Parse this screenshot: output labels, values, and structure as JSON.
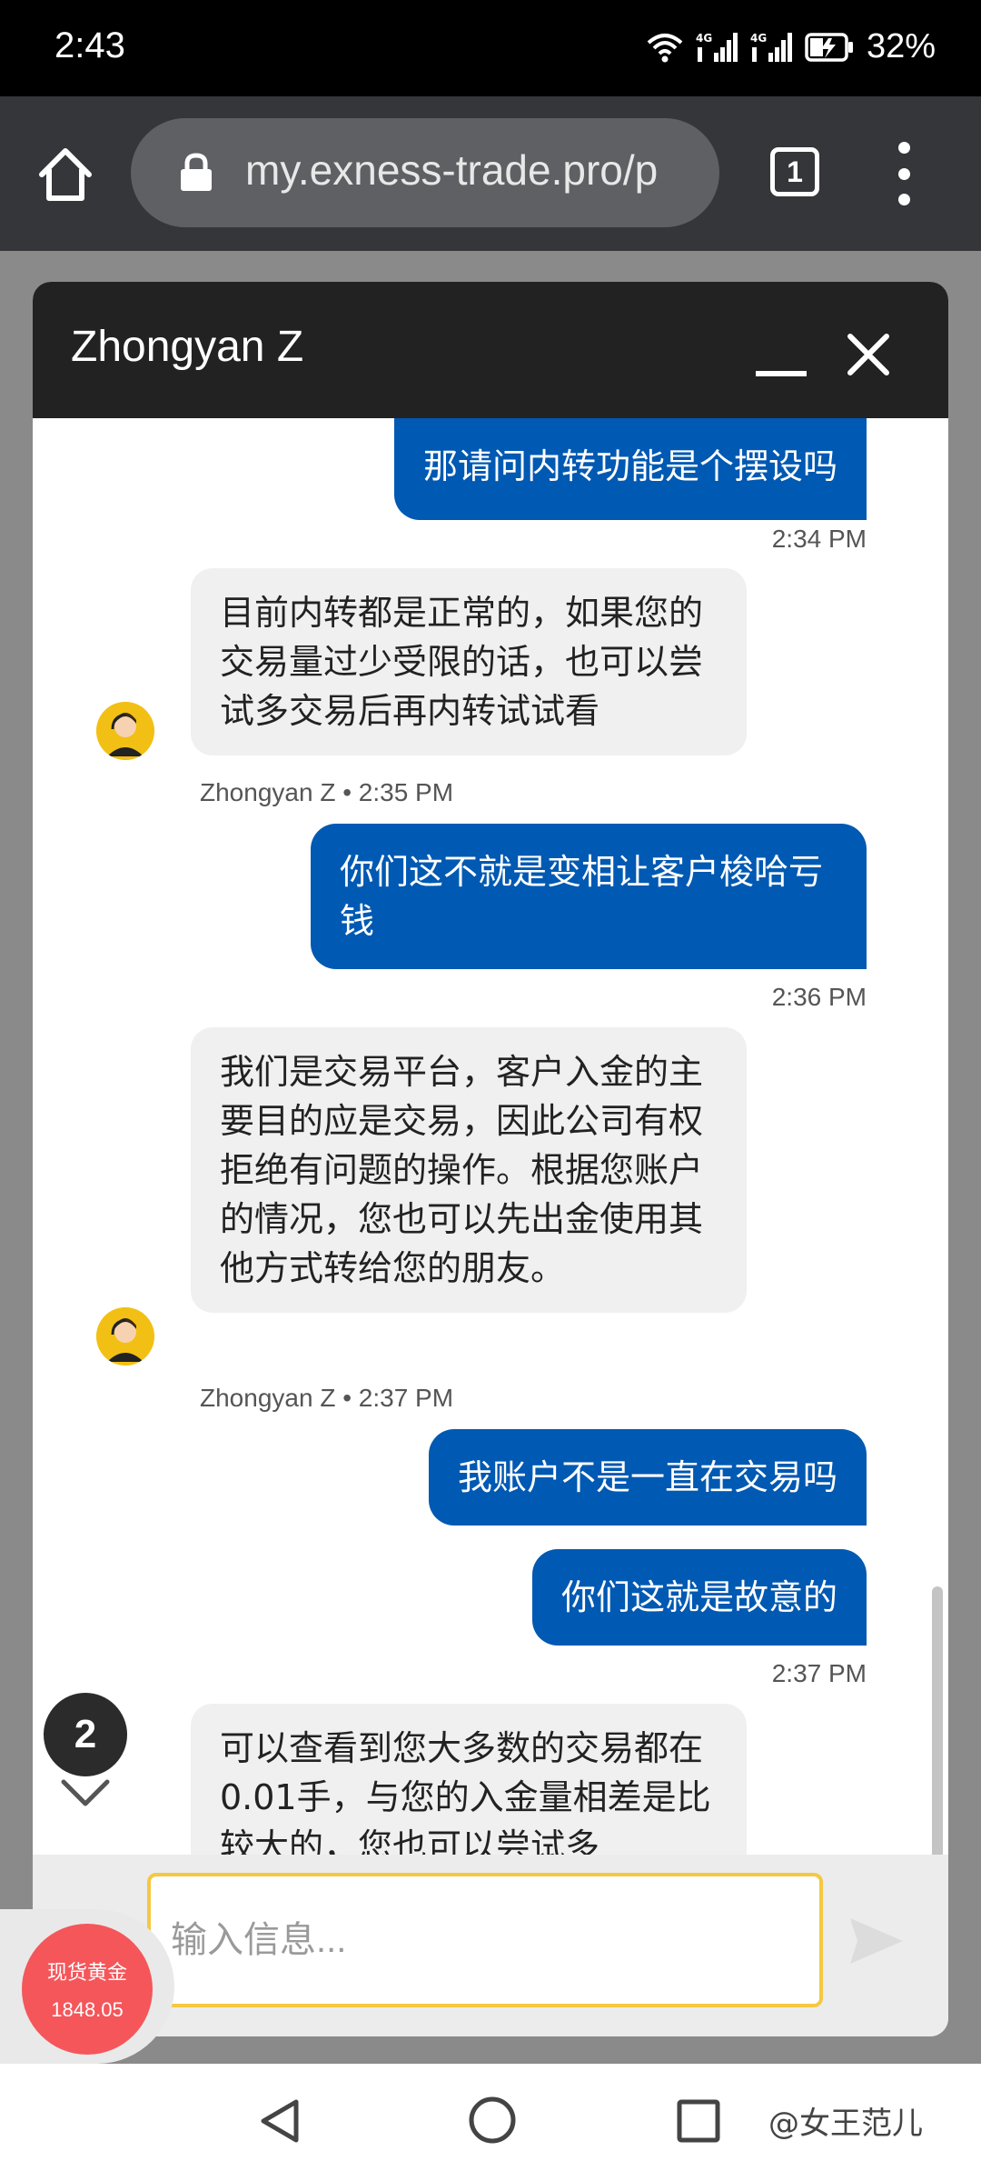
{
  "status_bar": {
    "time": "2:43",
    "battery": "32%",
    "icons": [
      "wifi-icon",
      "signal-4g-icon",
      "signal-4g-icon",
      "battery-charging-icon"
    ]
  },
  "browser": {
    "url": "my.exness-trade.pro/p",
    "tab_count": "1"
  },
  "chat": {
    "title": "Zhongyan Z",
    "messages": [
      {
        "from": "user",
        "text": "那请问内转功能是个摆设吗",
        "time": "2:34 PM"
      },
      {
        "from": "agent",
        "text": "目前内转都是正常的，如果您的交易量过少受限的话，也可以尝试多交易后再内转试试看",
        "meta": "Zhongyan Z • 2:35 PM"
      },
      {
        "from": "user",
        "text": "你们这不就是变相让客户梭哈亏钱",
        "time": "2:36 PM"
      },
      {
        "from": "agent",
        "text": "我们是交易平台，客户入金的主要目的应是交易，因此公司有权拒绝有问题的操作。根据您账户的情况，您也可以先出金使用其他方式转给您的朋友。",
        "meta": "Zhongyan Z • 2:37 PM"
      },
      {
        "from": "user",
        "text": "我账户不是一直在交易吗"
      },
      {
        "from": "user",
        "text": "你们这就是故意的",
        "time": "2:37 PM"
      },
      {
        "from": "agent",
        "text": "可以查看到您大多数的交易都在0.01手，与您的入金量相差是比较大的，您也可以尝试多"
      }
    ],
    "input_placeholder": "输入信息...",
    "unread_count": "2"
  },
  "gold_widget": {
    "label": "现货黄金",
    "price": "1848.05"
  },
  "watermark": "@女王范儿",
  "colors": {
    "outgoing_bubble": "#0059b2",
    "incoming_bubble": "#f0f0f0",
    "header": "#222222",
    "input_border": "#f5c842",
    "gold_widget": "#f5565a"
  }
}
